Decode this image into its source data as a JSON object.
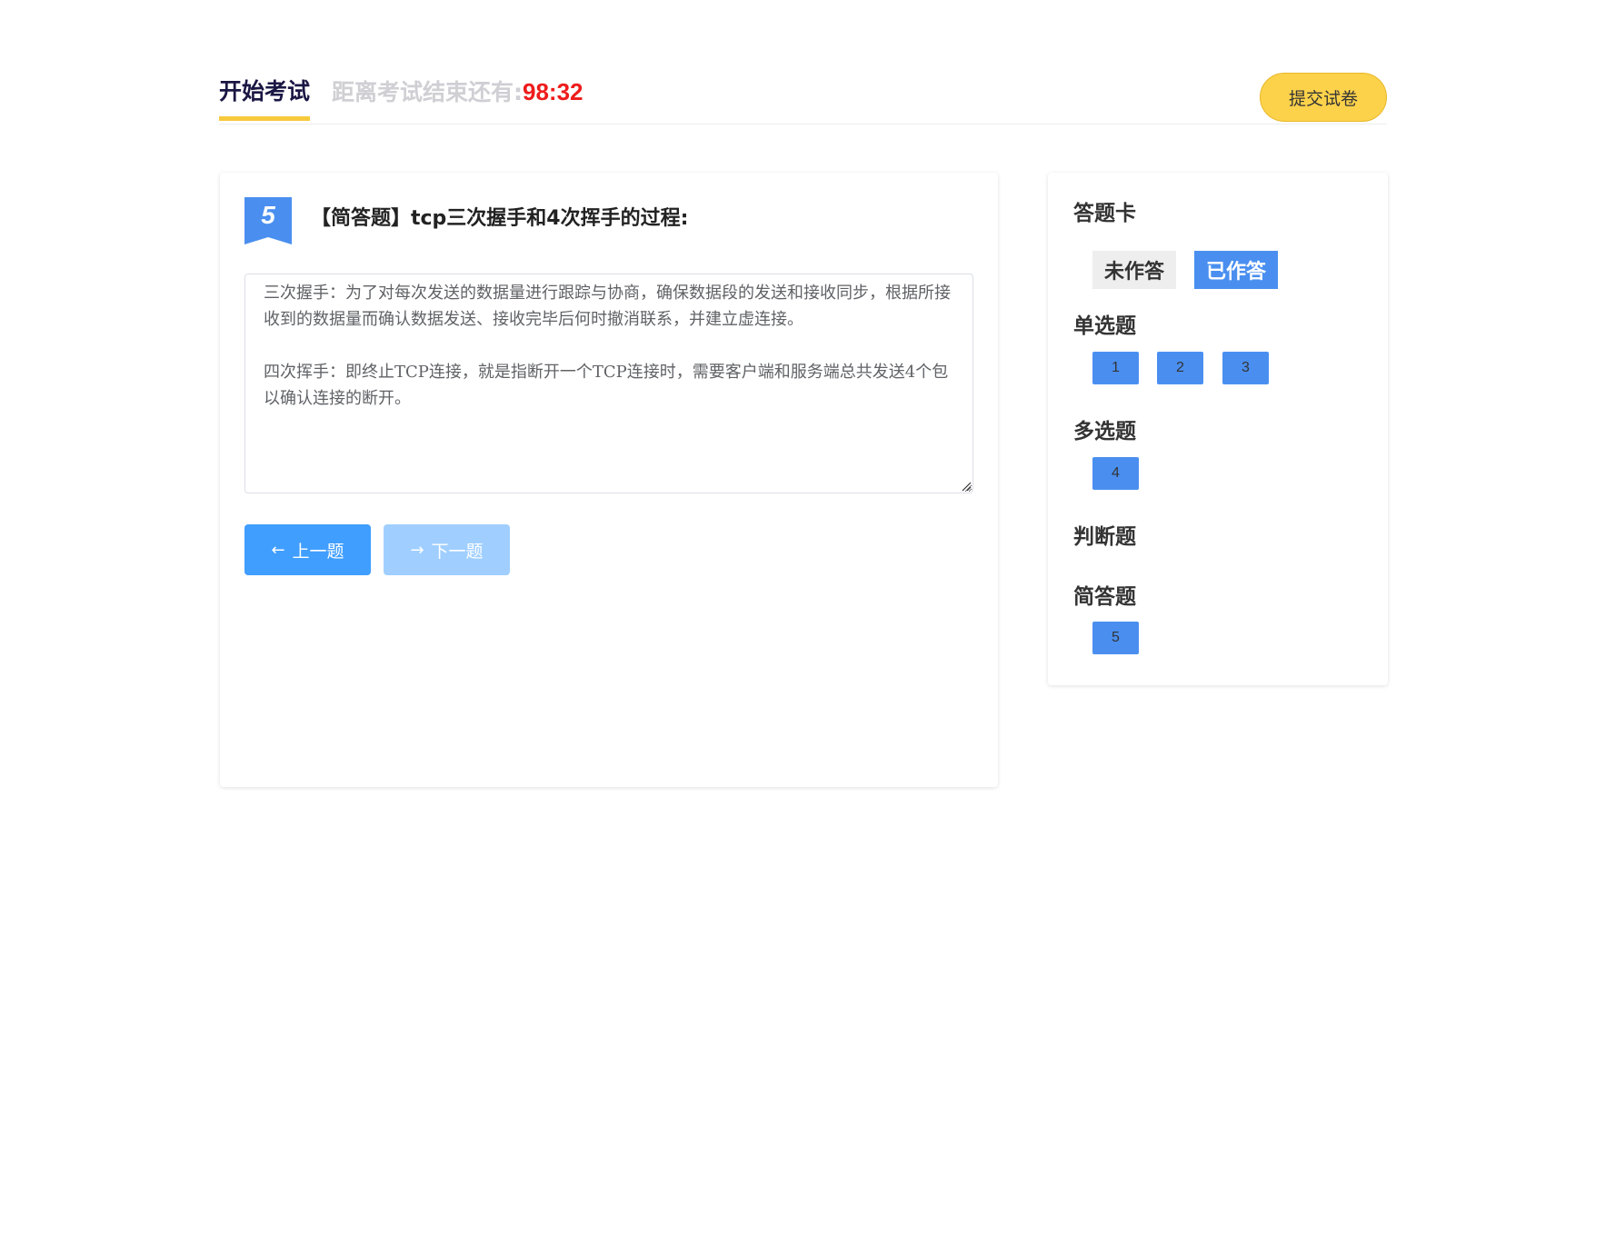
{
  "header": {
    "title": "开始考试",
    "countdown_label": "距离考试结束还有:",
    "countdown_time": "98:32",
    "submit_label": "提交试卷"
  },
  "question": {
    "number": "5",
    "title": "【简答题】tcp三次握手和4次挥手的过程:",
    "answer": "三次握手：为了对每次发送的数据量进行跟踪与协商，确保数据段的发送和接收同步，根据所接收到的数据量而确认数据发送、接收完毕后何时撤消联系，并建立虚连接。\n\n四次挥手：即终止TCP连接，就是指断开一个TCP连接时，需要客户端和服务端总共发送4个包以确认连接的断开。",
    "prev_label": "上一题",
    "next_label": "下一题"
  },
  "answer_card": {
    "title": "答题卡",
    "legend_unanswered": "未作答",
    "legend_answered": "已作答",
    "sections": {
      "single": {
        "title": "单选题",
        "items": [
          "1",
          "2",
          "3"
        ]
      },
      "multiple": {
        "title": "多选题",
        "items": [
          "4"
        ]
      },
      "judge": {
        "title": "判断题",
        "items": []
      },
      "short": {
        "title": "简答题",
        "items": [
          "5"
        ]
      }
    }
  },
  "colors": {
    "accent_yellow": "#fdd24b",
    "answered_blue": "#4a8ff0",
    "primary_button": "#409eff",
    "disabled_button": "#a0cfff",
    "timer_red": "#ee1c1c"
  }
}
